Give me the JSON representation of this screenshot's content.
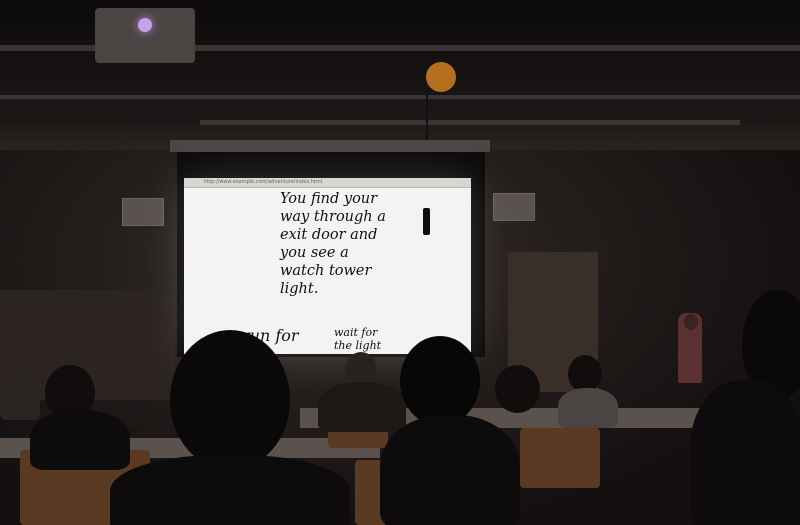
{
  "screen": {
    "url": "http://www.example.com/adventure/index.html",
    "story_lines": [
      "You find your",
      "way through a",
      "exit door and",
      "you see a",
      "watch tower",
      "light."
    ],
    "choices": [
      "run for",
      "wait for\nthe light"
    ]
  },
  "colors": {
    "screen": "#f4f3f1",
    "room": "#241e1c",
    "chairs": "#5a3a22",
    "ceiling_light": "#b5701f"
  }
}
